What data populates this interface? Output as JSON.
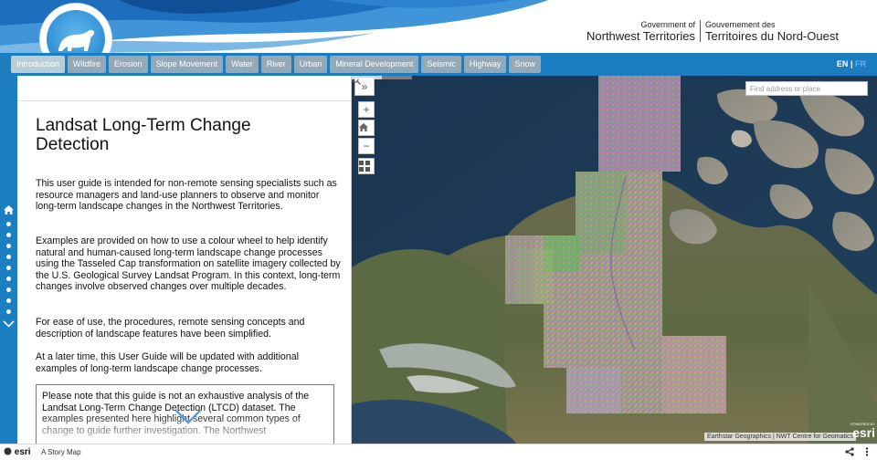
{
  "header": {
    "gov_en_small": "Government of",
    "gov_en_big": "Northwest Territories",
    "gov_fr_small": "Gouvernement des",
    "gov_fr_big": "Territoires du Nord-Ouest",
    "logo_icon": "polar-bear-icon"
  },
  "nav": {
    "tabs": [
      {
        "label": "Introduction"
      },
      {
        "label": "Wildfire"
      },
      {
        "label": "Erosion"
      },
      {
        "label": "Slope Movement"
      },
      {
        "label": "Water"
      },
      {
        "label": "River"
      },
      {
        "label": "Urban"
      },
      {
        "label": "Mineral Development"
      },
      {
        "label": "Seismic"
      },
      {
        "label": "Highway"
      },
      {
        "label": "Snow"
      }
    ],
    "lang_en": "EN",
    "lang_sep": "|",
    "lang_fr": "FR"
  },
  "panel": {
    "title": "Landsat Long-Term Change Detection",
    "p1": "This user guide is intended for non-remote sensing specialists such as resource managers and land-use planners to observe and monitor long-term landscape changes in the Northwest Territories.",
    "p2": "Examples are provided on how to use a colour wheel to help identify natural and human-caused long-term landscape change processes using the Tasseled Cap transformation on satellite imagery collected by the U.S. Geological Survey Landsat Program. In this context, long-term changes involve observed changes over multiple decades.",
    "p3": "For ease of use, the procedures, remote sensing concepts and description of landscape features have been simplified.",
    "p4": "At a later time, this User Guide will be updated with additional examples of long-term landscape change processes.",
    "note": "Please note that this guide is not an exhaustive analysis of the Landsat Long-Term Change Detection (LTCD) dataset. The examples presented here highlight several common types of change to guide further investigation. The Northwest"
  },
  "map": {
    "search_placeholder": "Find address or place",
    "attribution": "Earthstar Geographics | NWT Centre for Geomatics",
    "powered_by": "POWERED BY",
    "esri": "esri",
    "zoom_in": "+",
    "zoom_out": "−",
    "collapse": "»"
  },
  "footer": {
    "brand": "esri",
    "story": "A Story Map"
  },
  "colors": {
    "nav_blue": "#1d7dc1",
    "tab_grey": "#93a9b8",
    "tab_active": "#b9cdd8",
    "ocean": "#1d3a55"
  }
}
